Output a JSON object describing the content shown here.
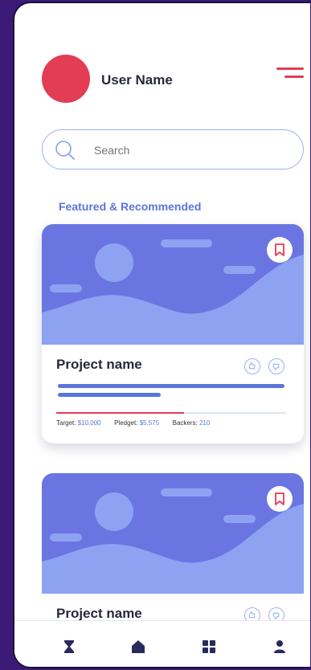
{
  "header": {
    "user_name": "User Name"
  },
  "search": {
    "placeholder": "Search"
  },
  "section": {
    "title": "Featured & Recommended"
  },
  "projects": [
    {
      "name": "Project name",
      "target_label": "Target:",
      "target_value": "$10,000",
      "pledged_label": "Pledget:",
      "pledged_value": "$5,575",
      "backers_label": "Backers:",
      "backers_value": "210",
      "progress": 0.5575
    },
    {
      "name": "Project name"
    }
  ],
  "colors": {
    "accent": "#5b75d8",
    "brand_red": "#e23d55",
    "frame": "#3b1a78"
  },
  "icons": {
    "menu": "hamburger-icon",
    "search": "search-icon",
    "bookmark": "bookmark-icon",
    "like": "thumbs-up-icon",
    "dislike": "thumbs-down-icon",
    "nav": [
      "hourglass-icon",
      "home-icon",
      "grid-icon",
      "user-icon"
    ]
  }
}
